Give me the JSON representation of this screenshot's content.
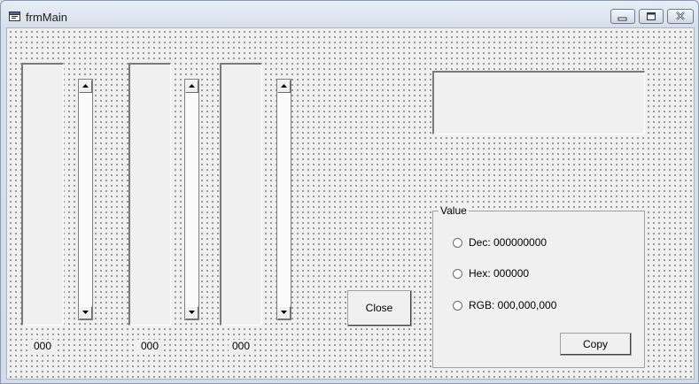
{
  "window": {
    "title": "frmMain",
    "icon": "form-icon"
  },
  "caption_buttons": [
    "minimize-icon",
    "maximize-icon",
    "close-icon"
  ],
  "channels": [
    {
      "value_label": "000"
    },
    {
      "value_label": "000"
    },
    {
      "value_label": "000"
    }
  ],
  "close_button": {
    "label": "Close"
  },
  "value_frame": {
    "caption": "Value",
    "options": [
      {
        "label": "Dec: 000000000",
        "selected": false
      },
      {
        "label": "Hex: 000000",
        "selected": false
      },
      {
        "label": "RGB: 000,000,000",
        "selected": false
      }
    ],
    "copy_label": "Copy"
  },
  "colors": {
    "form_background": "#f0f0f0",
    "grid_dots": "#2b2b2b",
    "title_bar": "#d6dfea"
  }
}
